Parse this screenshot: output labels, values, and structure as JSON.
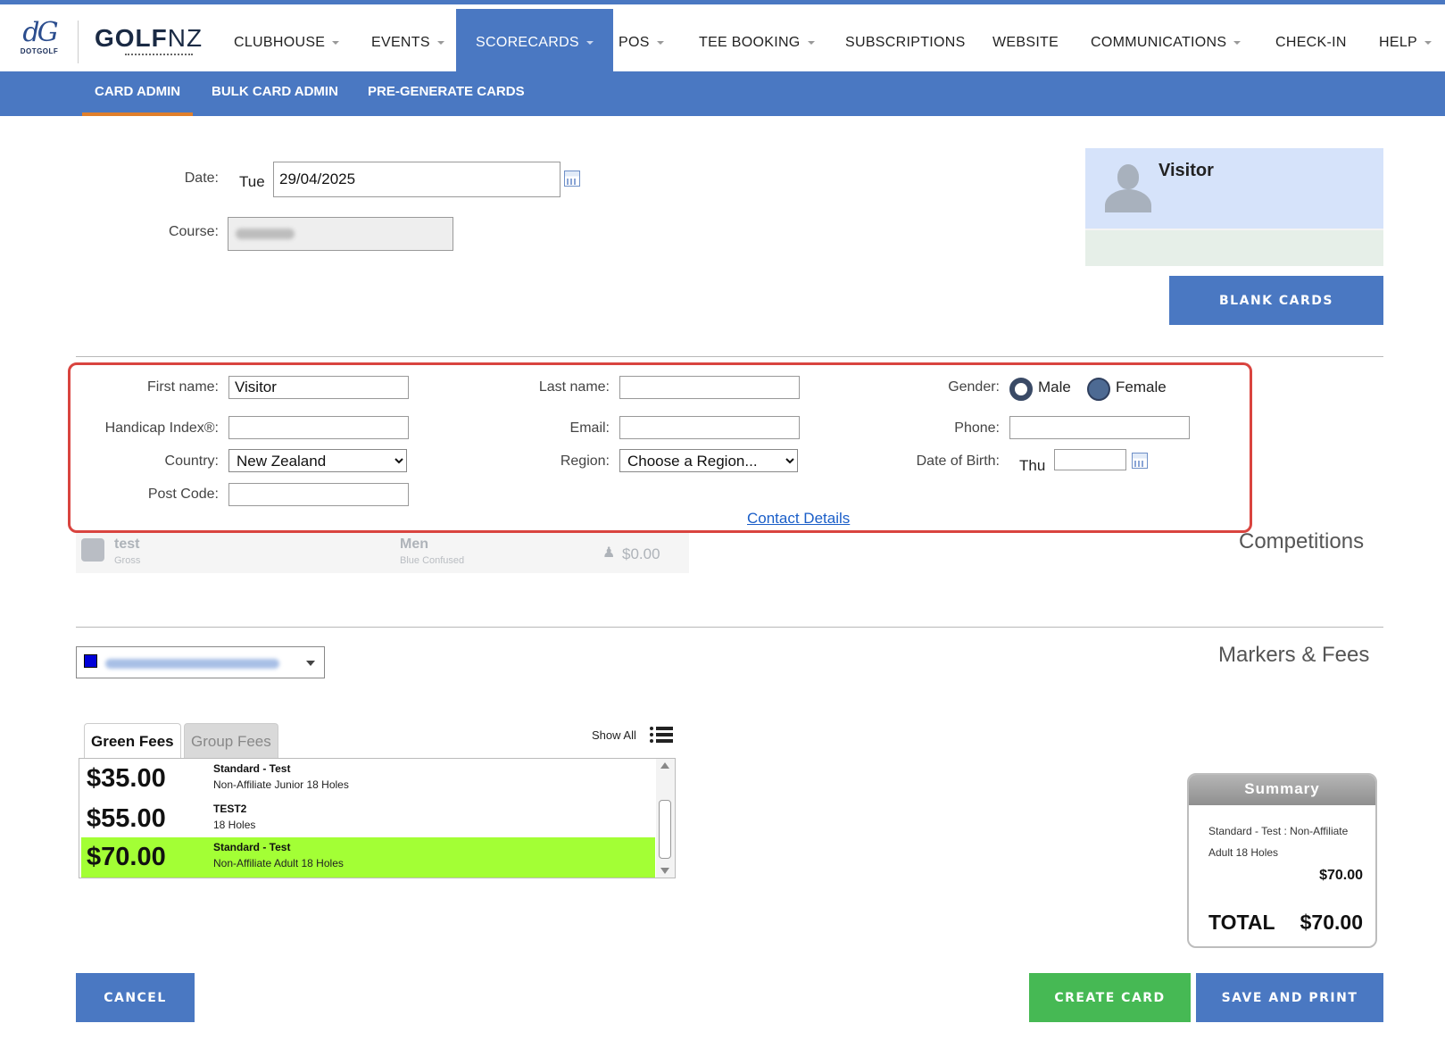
{
  "brand": {
    "logo_mark": "dG",
    "logo_sub": "DOTGOLF",
    "golf_bold": "GOLF",
    "golf_light": "NZ"
  },
  "nav": {
    "items": [
      {
        "label": "CLUBHOUSE"
      },
      {
        "label": "EVENTS"
      },
      {
        "label": "SCORECARDS"
      },
      {
        "label": "POS"
      },
      {
        "label": "TEE BOOKING"
      },
      {
        "label": "SUBSCRIPTIONS"
      },
      {
        "label": "WEBSITE"
      },
      {
        "label": "COMMUNICATIONS"
      },
      {
        "label": "CHECK-IN"
      },
      {
        "label": "HELP"
      }
    ],
    "active": "SCORECARDS"
  },
  "subnav": {
    "items": [
      {
        "label": "CARD ADMIN"
      },
      {
        "label": "BULK CARD ADMIN"
      },
      {
        "label": "PRE-GENERATE CARDS"
      }
    ],
    "active": "CARD ADMIN"
  },
  "card": {
    "date_label": "Date:",
    "day": "Tue",
    "date_value": "29/04/2025",
    "course_label": "Course:"
  },
  "visitor": {
    "name": "Visitor",
    "blank_cards_label": "BLANK CARDS"
  },
  "contact": {
    "first_name_label": "First name:",
    "first_name_value": "Visitor",
    "last_name_label": "Last name:",
    "last_name_value": "",
    "gender_label": "Gender:",
    "gender_male": "Male",
    "gender_female": "Female",
    "handicap_label": "Handicap Index®:",
    "handicap_value": "",
    "email_label": "Email:",
    "email_value": "",
    "phone_label": "Phone:",
    "phone_value": "",
    "country_label": "Country:",
    "country_value": "New Zealand",
    "region_label": "Region:",
    "region_value": "Choose a Region...",
    "dob_label": "Date of Birth:",
    "dob_day": "Thu",
    "dob_value": "",
    "postcode_label": "Post Code:",
    "postcode_value": "",
    "contact_details_link": "Contact Details"
  },
  "competitions": {
    "title": "Competitions",
    "row": {
      "name": "test",
      "sub": "Gross",
      "division": "Men",
      "tee": "Blue Confused",
      "price": "$0.00"
    }
  },
  "markers": {
    "title": "Markers & Fees",
    "swatch_color": "#0000d8"
  },
  "fees": {
    "tab_green": "Green Fees",
    "tab_group": "Group Fees",
    "show_all": "Show All",
    "rows": [
      {
        "price": "$35.00",
        "name": "Standard - Test",
        "desc": "Non-Affiliate Junior 18 Holes",
        "selected": false
      },
      {
        "price": "$55.00",
        "name": "TEST2",
        "desc": "18 Holes",
        "selected": false
      },
      {
        "price": "$70.00",
        "name": "Standard - Test",
        "desc": "Non-Affiliate Adult 18 Holes",
        "selected": true
      }
    ],
    "selected_color": "#a3ff35"
  },
  "summary": {
    "title": "Summary",
    "line1": "Standard - Test : Non-Affiliate",
    "line2": "Adult 18 Holes",
    "amount": "$70.00",
    "total_label": "TOTAL",
    "total_value": "$70.00"
  },
  "actions": {
    "cancel": "CANCEL",
    "create": "CREATE CARD",
    "save_print": "SAVE AND PRINT"
  },
  "colors": {
    "primary": "#4a78c2",
    "accent": "#e07f2b",
    "green": "#46b954",
    "highlight": "#d9443f"
  }
}
